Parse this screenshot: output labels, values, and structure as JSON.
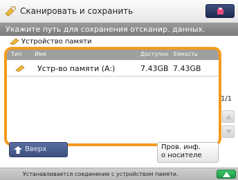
{
  "window": {
    "title": "Сканировать и сохранить",
    "title_icon": "scan-save-icon",
    "menu_button_icon": "counter-check-icon"
  },
  "banner": {
    "text": "Укажите путь для сохранения отсканир. данных."
  },
  "location": {
    "label": "Устройство памяти",
    "icon": "memory-stick-icon"
  },
  "list": {
    "columns": {
      "type": "Тип",
      "name": "Имя",
      "available": "Доступно",
      "capacity": "Емкость"
    },
    "rows": [
      {
        "icon": "memory-stick-icon",
        "name": "Устр-во памяти (A:)",
        "available": "7.43GB",
        "capacity": "7.43GB"
      }
    ],
    "page_indicator": "1/1"
  },
  "buttons": {
    "up": "Вверх",
    "check_media": "Пров. инф.\nо носителе"
  },
  "status": {
    "text": "Устанавливается соединение с устройством памяти.",
    "indicator_color": "#2fae57"
  },
  "colors": {
    "accent": "#f39a1e",
    "banner": "#8a8a8a",
    "header": "#9f9f9f"
  }
}
